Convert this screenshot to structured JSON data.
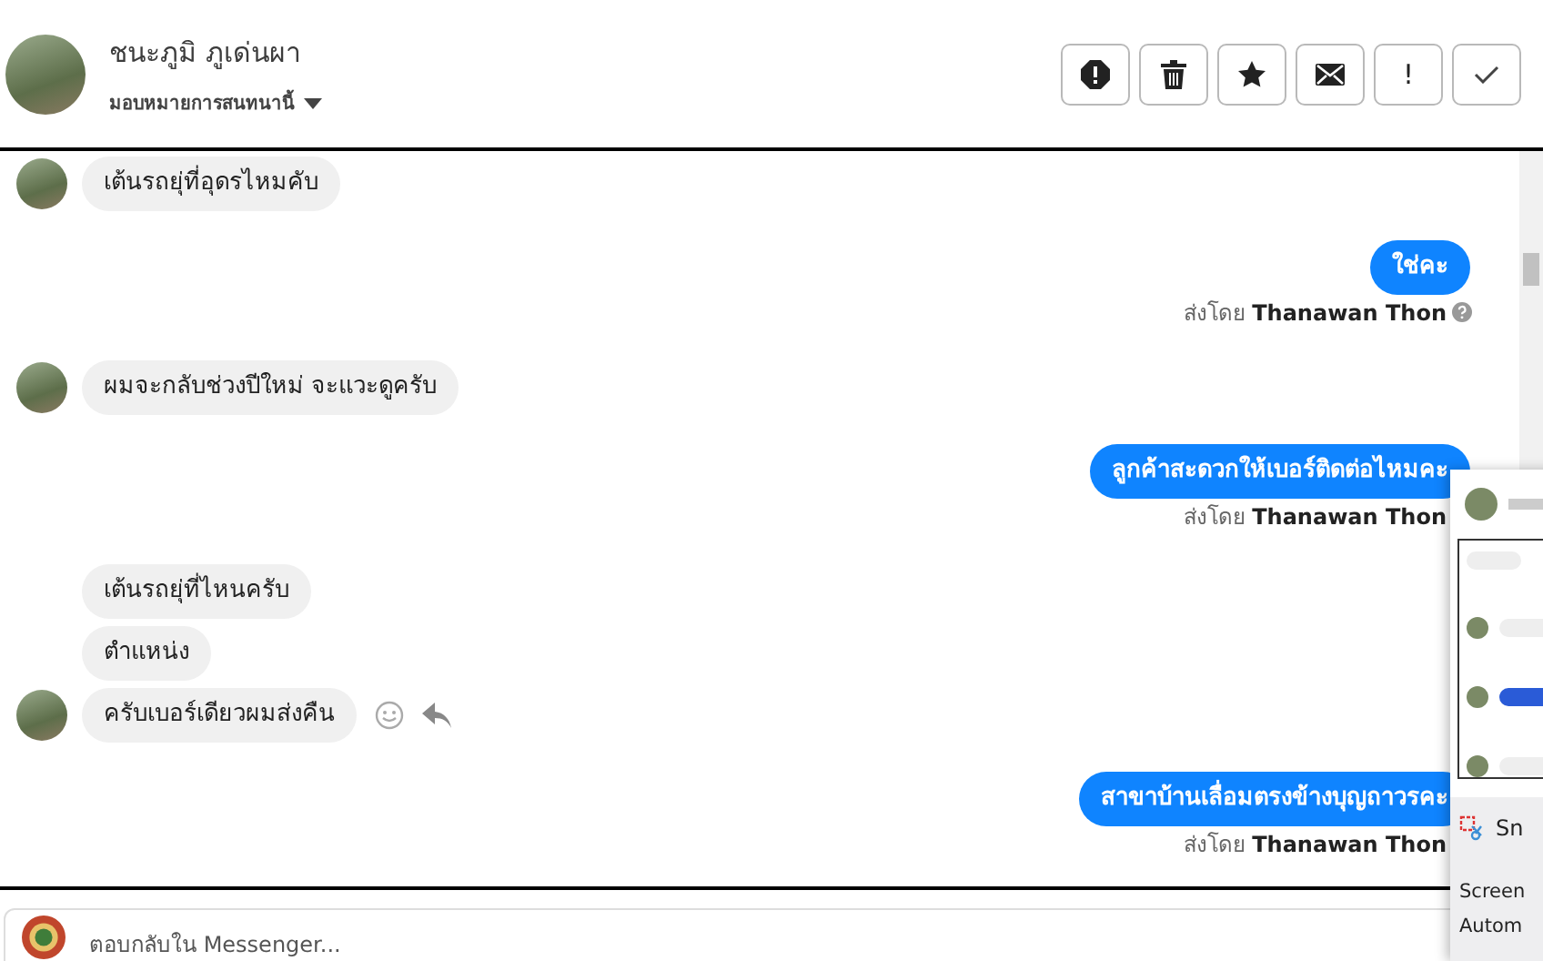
{
  "header": {
    "name": "ชนะภูมิ ภูเด่นผา",
    "assign_label": "มอบหมายการสนทนานี้",
    "actions": [
      {
        "kind": "alert"
      },
      {
        "kind": "trash"
      },
      {
        "kind": "star"
      },
      {
        "kind": "mail"
      },
      {
        "kind": "text",
        "label": "!"
      },
      {
        "kind": "check"
      }
    ]
  },
  "messages": [
    {
      "kind": "incoming",
      "text": "เต้นรถยุ่ที่อุดรไหมคับ",
      "avatar": true
    },
    {
      "kind": "outgoing",
      "text": "ใช่คะ",
      "sent_by": "ส่งโดย",
      "sender": "Thanawan Thon",
      "help_icon": true
    },
    {
      "kind": "incoming",
      "text": "ผมจะกลับช่วงปีใหม่ จะแวะดูครับ",
      "avatar": true
    },
    {
      "kind": "outgoing",
      "text": "ลูกค้าสะดวกให้เบอร์ติดต่อไหมคะ",
      "sent_by": "ส่งโดย",
      "sender": "Thanawan Thon"
    },
    {
      "kind": "incoming",
      "text": "เต้นรถยุ่ที่ไหนครับ",
      "avatar": false
    },
    {
      "kind": "incoming",
      "text": "ตำแหน่ง",
      "avatar": false
    },
    {
      "kind": "incoming",
      "text": "ครับเบอร์เดียวผมส่งคืน",
      "avatar": true,
      "hover_actions": true
    },
    {
      "kind": "outgoing",
      "text": "สาขาบ้านเลื่อมตรงข้างบุญถาวรคะ",
      "sent_by": "ส่งโดย",
      "sender": "Thanawan Thon"
    }
  ],
  "reply": {
    "placeholder": "ตอบกลับใน Messenger..."
  },
  "popup": {
    "tool_label": "Sn",
    "title": "Screen",
    "subtitle": "Autom"
  }
}
